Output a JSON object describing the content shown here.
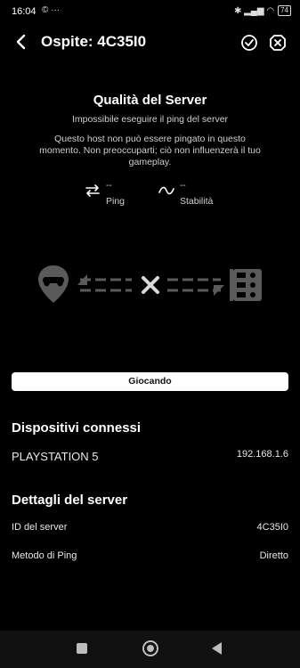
{
  "status_bar": {
    "time": "16:04",
    "left_icons": [
      "whatsapp-icon",
      "more-dots-icon"
    ],
    "right_icons": [
      "bluetooth-icon",
      "signal-icon",
      "wifi-icon",
      "battery-icon"
    ],
    "left_glyphs": "© ···",
    "right_glyphs": "✱ ▂▄▆ ◠",
    "battery": "74"
  },
  "header": {
    "title": "Ospite: 4C35I0"
  },
  "server_quality": {
    "title": "Qualità del Server",
    "error": "Impossibile eseguire il ping del server",
    "note": "Questo host non può essere pingato in questo momento. Non preoccuparti; ciò non influenzerà il tuo gameplay.",
    "ping_value": "--",
    "ping_label": "Ping",
    "stability_value": "--",
    "stability_label": "Stabilità"
  },
  "status_button": "Giocando",
  "connected_devices": {
    "title": "Dispositivi connessi",
    "device_name": "PLAYSTATION 5",
    "device_ip": "192.168.1.6"
  },
  "server_details": {
    "title": "Dettagli del server",
    "rows": [
      {
        "label": "ID del server",
        "value": "4C35I0"
      },
      {
        "label": "Metodo di Ping",
        "value": "Diretto"
      }
    ]
  },
  "colors": {
    "background": "#000000",
    "text": "#ffffff",
    "muted": "#cfcfcf",
    "diagram": "#555555",
    "button_bg": "#ffffff"
  }
}
